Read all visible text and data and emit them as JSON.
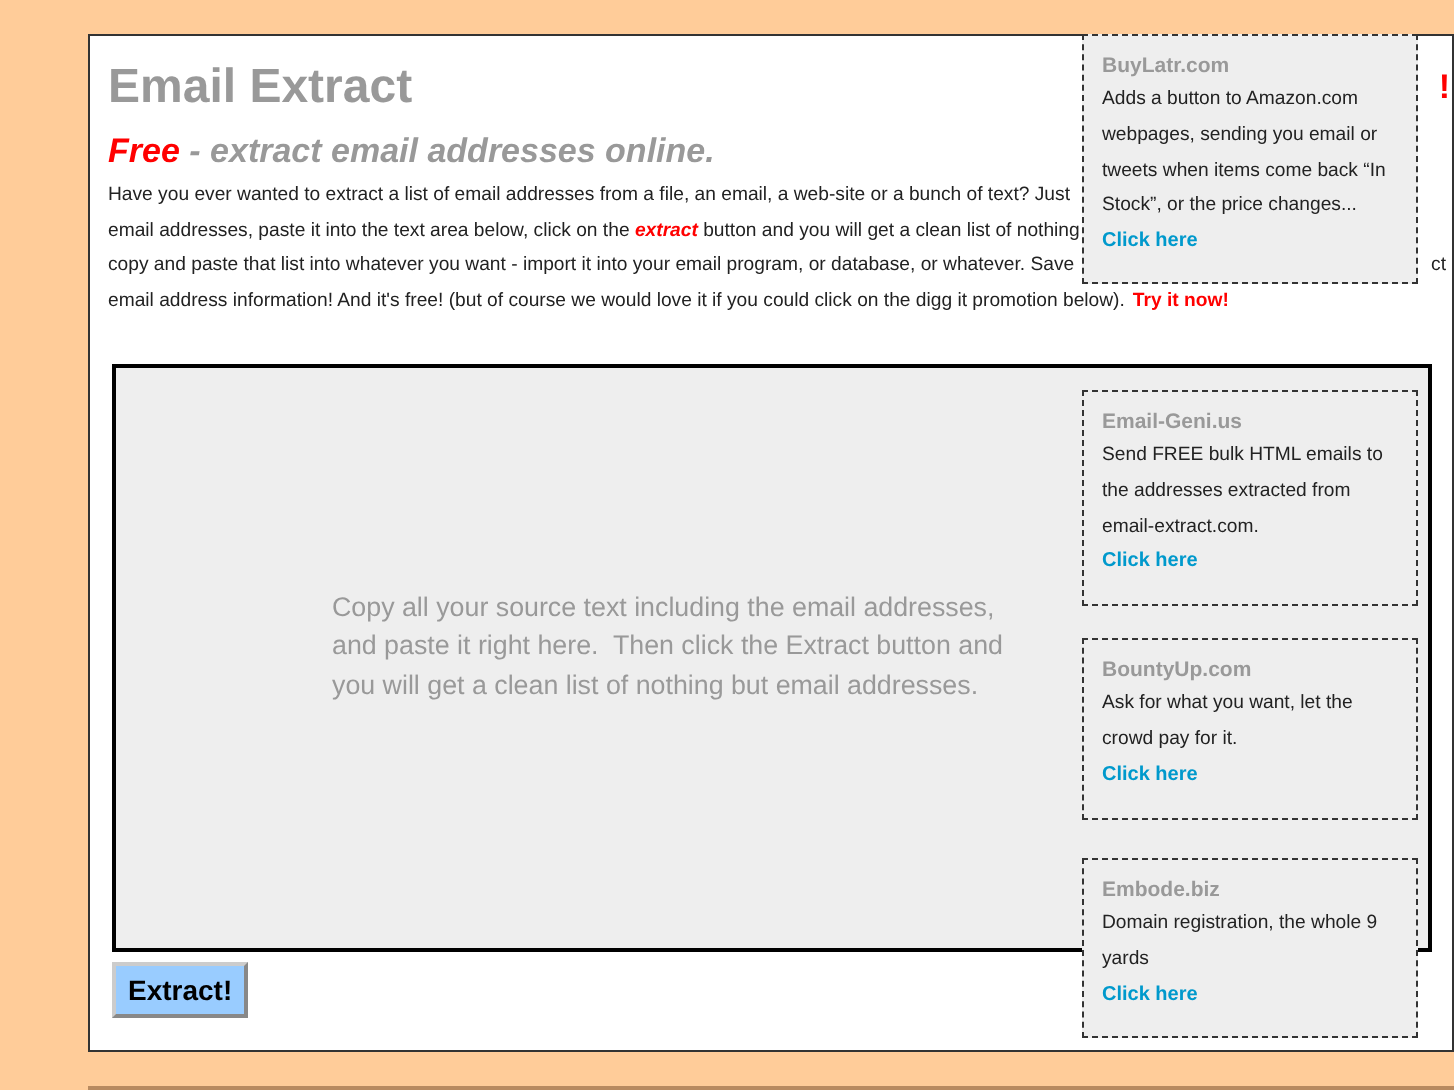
{
  "header": {
    "title": "Email Extract",
    "title_tail": "!"
  },
  "tagline": {
    "highlight": "Free",
    "rest": "- extract email addresses online."
  },
  "intro_lines": [
    {
      "left": "Have you ever wanted to extract a list of email addresses from a file, an email, a web-site or a bunch of text? Just"
    },
    {
      "left": "email addresses, paste it into the text area below, click on the *extract* button and you will get a clean list of nothing"
    },
    {
      "left": "copy and paste that list into whatever you want - import it into your email program, or database, or whatever. Save",
      "right": "ct"
    },
    {
      "left": "email address information! And it's free! (but of course we would love it if you could click on the digg it promotion below).",
      "link": "Try it now!"
    }
  ],
  "source_text": {
    "placeholder": "Copy all your source text including the email addresses,\nand paste it right here.  Then click the Extract button and\nyou will get a clean list of nothing but email addresses."
  },
  "extract_button": "Extract!",
  "ads": [
    {
      "title": "BuyLatr.com",
      "text": "Adds a button to Amazon.com webpages, sending you email or tweets when items come back “In Stock”, or the price changes...",
      "link": "Click here"
    },
    {
      "title": "Email-Geni.us",
      "text": "Send FREE bulk HTML emails to the addresses extracted from email-extract.com.",
      "link": "Click here"
    },
    {
      "title": "BountyUp.com",
      "text": "Ask for what you want, let the crowd pay for it.",
      "link": "Click here"
    },
    {
      "title": "Embode.biz",
      "text": "Domain registration, the whole 9 yards",
      "link": "Click here"
    }
  ]
}
